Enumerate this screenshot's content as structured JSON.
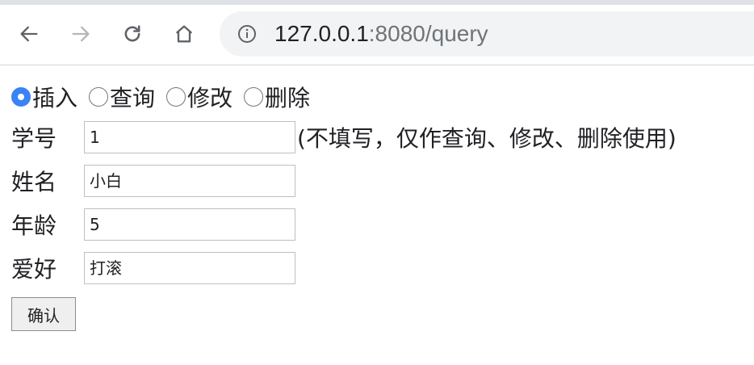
{
  "browser": {
    "url_host": "127.0.0.1",
    "url_rest": ":8080/query"
  },
  "form": {
    "radios": [
      {
        "label": "插入",
        "checked": true
      },
      {
        "label": "查询",
        "checked": false
      },
      {
        "label": "修改",
        "checked": false
      },
      {
        "label": "删除",
        "checked": false
      }
    ],
    "fields": [
      {
        "label": "学号",
        "value": "1"
      },
      {
        "label": "姓名",
        "value": "小白"
      },
      {
        "label": "年龄",
        "value": "5"
      },
      {
        "label": "爱好",
        "value": "打滚"
      }
    ],
    "id_note": "(不填写，仅作查询、修改、删除使用)",
    "submit_label": "确认"
  },
  "colors": {
    "radio_checked": "#3b82f6",
    "omnibox_bg": "#f1f3f4"
  },
  "icons": {
    "back": "back-arrow-icon",
    "forward": "forward-arrow-icon",
    "reload": "reload-icon",
    "home": "home-icon",
    "info": "info-icon"
  }
}
